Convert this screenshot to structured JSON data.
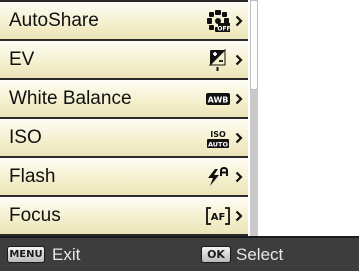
{
  "menu": {
    "items": [
      {
        "label": "AutoShare",
        "icon": "autoshare-off-icon"
      },
      {
        "label": "EV",
        "icon": "exposure-value-icon"
      },
      {
        "label": "White Balance",
        "icon": "awb-icon",
        "icon_text": "AWB"
      },
      {
        "label": "ISO",
        "icon": "iso-auto-icon",
        "icon_text_top": "ISO",
        "icon_text_bottom": "AUTO"
      },
      {
        "label": "Flash",
        "icon": "flash-auto-icon"
      },
      {
        "label": "Focus",
        "icon": "autofocus-icon",
        "icon_text": "AF"
      }
    ]
  },
  "bottom_bar": {
    "menu_button": "MENU",
    "exit_label": "Exit",
    "ok_button": "OK",
    "select_label": "Select"
  },
  "colors": {
    "row_top": "#fefdf5",
    "row_bottom": "#ece5b8",
    "panel_dark": "#2a2a2a",
    "bottom_bar": "#3d3d3d"
  }
}
